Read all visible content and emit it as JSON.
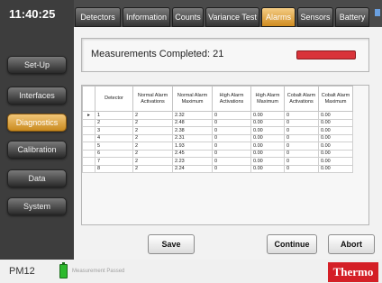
{
  "clock": "11:40:25",
  "tabs": [
    "Detectors",
    "Information",
    "Counts",
    "Variance Test",
    "Alarms",
    "Sensors",
    "Battery"
  ],
  "active_tab": "Alarms",
  "sidebar": {
    "items": [
      "Set-Up",
      "Interfaces",
      "Diagnostics",
      "Calibration",
      "Data",
      "System"
    ],
    "active": "Diagnostics"
  },
  "measurement": {
    "label": "Measurements Completed: 21"
  },
  "table": {
    "columns": [
      "",
      "Detector",
      "Normal Alarm Activations",
      "Normal Alarm Maximum",
      "High Alarm Activations",
      "High Alarm Maximum",
      "Cobalt Alarm Activations",
      "Cobalt Alarm Maximum"
    ],
    "selector": "▸",
    "rows": [
      [
        "1",
        "2",
        "2.32",
        "0",
        "0.00",
        "0",
        "0.00"
      ],
      [
        "2",
        "2",
        "2.48",
        "0",
        "0.00",
        "0",
        "0.00"
      ],
      [
        "3",
        "2",
        "2.38",
        "0",
        "0.00",
        "0",
        "0.00"
      ],
      [
        "4",
        "2",
        "2.31",
        "0",
        "0.00",
        "0",
        "0.00"
      ],
      [
        "5",
        "2",
        "1.93",
        "0",
        "0.00",
        "0",
        "0.00"
      ],
      [
        "6",
        "2",
        "2.45",
        "0",
        "0.00",
        "0",
        "0.00"
      ],
      [
        "7",
        "2",
        "2.23",
        "0",
        "0.00",
        "0",
        "0.00"
      ],
      [
        "8",
        "2",
        "2.24",
        "0",
        "0.00",
        "0",
        "0.00"
      ]
    ]
  },
  "buttons": {
    "save": "Save",
    "continue": "Continue",
    "abort": "Abort"
  },
  "footer": {
    "device": "PM12",
    "status": "Measurement Passed",
    "logo": "Thermo"
  },
  "colors": {
    "accent": "#d08c20",
    "alarm": "#d9333a",
    "logo": "#d41f26",
    "battery": "#2db92d"
  }
}
